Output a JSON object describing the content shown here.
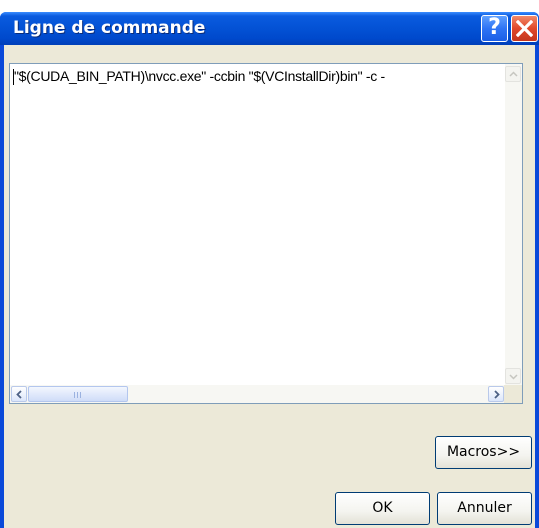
{
  "dialog": {
    "title": "Ligne de commande",
    "help_button_label": "?",
    "close_icon": "close-icon"
  },
  "editor": {
    "command_text": "\"$(CUDA_BIN_PATH)\\nvcc.exe\" -ccbin \"$(VCInstallDir)bin\" -c -"
  },
  "buttons": {
    "macros": "Macros>>",
    "ok": "OK",
    "cancel": "Annuler"
  }
}
